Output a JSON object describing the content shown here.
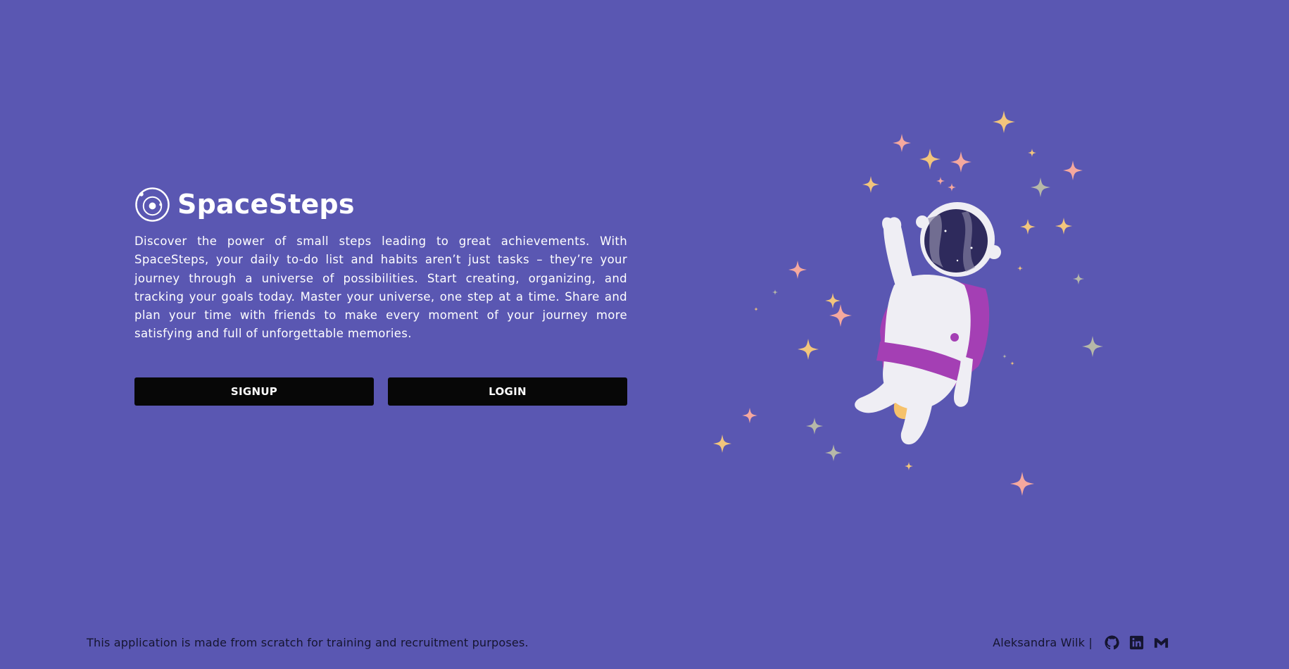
{
  "brand": {
    "name": "SpaceSteps",
    "logo_icon": "orbit-logo-icon"
  },
  "hero": {
    "description": "Discover the power of small steps leading to great achievements. With SpaceSteps, your daily to-do list and habits aren’t just tasks – they’re your journey through a universe of possibilities. Start creating, organizing, and tracking your goals today. Master your universe, one step at a time. Share and plan your time with friends to make every moment of your journey more satisfying and full of unforgettable memories."
  },
  "actions": {
    "signup_label": "SIGNUP",
    "login_label": "LOGIN"
  },
  "illustration": {
    "icon": "astronaut-illustration"
  },
  "footer": {
    "note": "This application is made from scratch for training and recruitment purposes.",
    "author": "Aleksandra Wilk |",
    "links": [
      "github-icon",
      "linkedin-icon",
      "gmail-icon"
    ]
  },
  "colors": {
    "background": "#5a57b2",
    "button": "#070707",
    "text": "#ffffff",
    "footer_text": "#151530",
    "accent_purple": "#a43fb4",
    "star_yellow": "#f2c57c",
    "star_pink": "#f5a89e",
    "star_gray": "#b6b8a8"
  }
}
